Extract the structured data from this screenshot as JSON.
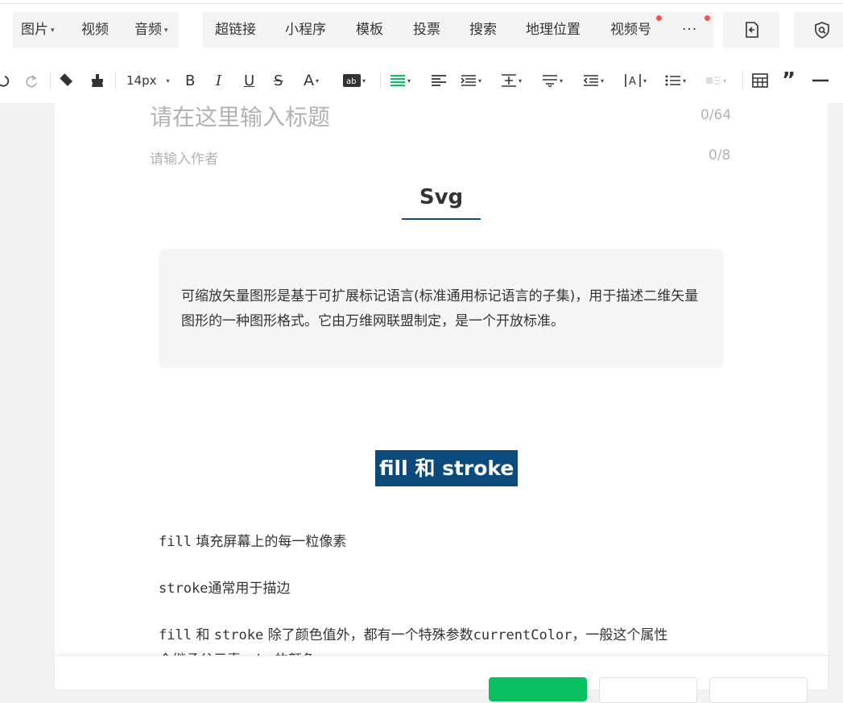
{
  "insert_bar": {
    "media": [
      {
        "label": "图片",
        "dropdown": true
      },
      {
        "label": "视频",
        "dropdown": false
      },
      {
        "label": "音频",
        "dropdown": true
      }
    ],
    "tools": [
      {
        "label": "超链接"
      },
      {
        "label": "小程序"
      },
      {
        "label": "模板"
      },
      {
        "label": "投票"
      },
      {
        "label": "搜索"
      },
      {
        "label": "地理位置"
      },
      {
        "label": "视频号",
        "badge": true
      },
      {
        "label": "···",
        "badge": true
      }
    ],
    "icons": [
      "document-import-icon",
      "shield-search-icon"
    ]
  },
  "format_bar": {
    "font_size": "14px",
    "icons": [
      "undo-icon",
      "redo-icon",
      "clear-format-icon",
      "format-brush-icon",
      "font-size-select",
      "bold-icon",
      "italic-icon",
      "underline-icon",
      "strikethrough-icon",
      "font-color-icon",
      "background-color-icon",
      "align-icon",
      "indent-icon",
      "first-line-indent-icon",
      "line-height-icon",
      "paragraph-spacing-icon",
      "outdent-icon",
      "letter-spacing-icon",
      "list-icon",
      "text-direction-icon",
      "table-icon",
      "quote-icon",
      "horizontal-rule-icon"
    ],
    "active_color": "#07c160"
  },
  "article": {
    "title_placeholder": "请在这里输入标题",
    "title_count": "0/64",
    "author_placeholder": "请输入作者",
    "author_count": "0/8",
    "heading1": "Svg",
    "quote": "可缩放矢量图形是基于可扩展标记语言(标准通用标记语言的子集)，用于描述二维矢量图形的一种图形格式。它由万维网联盟制定，是一个开放标准。",
    "heading2": "fill 和 stroke",
    "p1_code": "fill",
    "p1_text": " 填充屏幕上的每一粒像素",
    "p2_code": "stroke",
    "p2_text": "通常用于描边",
    "p3_a": "fill",
    "p3_b": " 和 ",
    "p3_c": "stroke",
    "p3_d": " 除了颜色值外，都有一个特殊参数",
    "p3_e": "currentColor",
    "p3_f": "，一般这个属性",
    "p4": "会继承父元素color的颜色"
  },
  "colors": {
    "accent_green": "#07c160",
    "heading_underline": "#1a4a7a",
    "heading2_bg": "#0d4a7c",
    "badge_red": "#fa5151"
  }
}
